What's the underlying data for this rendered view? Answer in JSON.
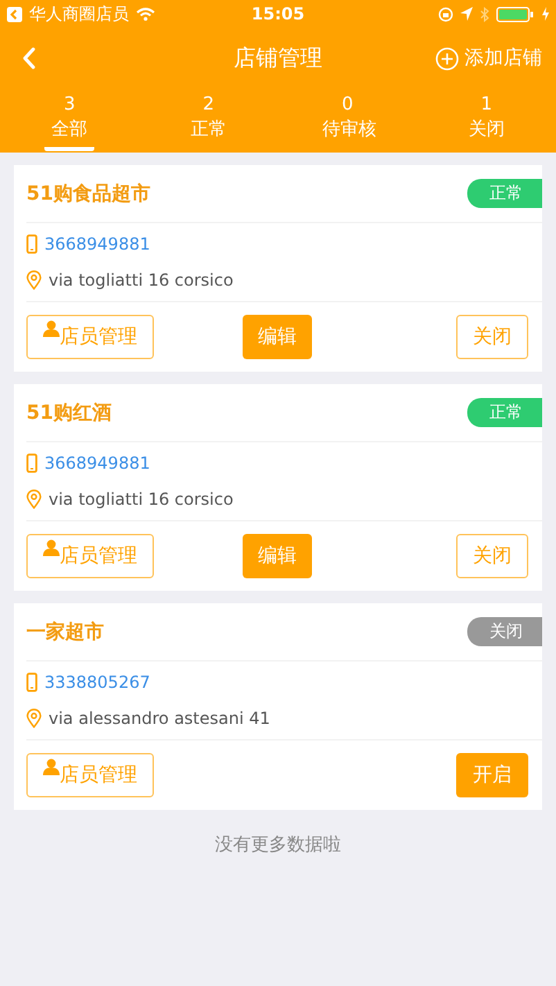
{
  "status_bar": {
    "carrier": "华人商圈店员",
    "time": "15:05"
  },
  "nav": {
    "title": "店铺管理",
    "action": "添加店铺"
  },
  "tabs": [
    {
      "count": "3",
      "label": "全部",
      "selected": true
    },
    {
      "count": "2",
      "label": "正常",
      "selected": false
    },
    {
      "count": "0",
      "label": "待审核",
      "selected": false
    },
    {
      "count": "1",
      "label": "关闭",
      "selected": false
    }
  ],
  "stores": [
    {
      "name": "51购食品超市",
      "status": {
        "label": "正常",
        "color": "#2ecc71"
      },
      "phone": "3668949881",
      "address": "via togliatti 16 corsico",
      "actions": [
        {
          "kind": "staff",
          "label": "店员管理"
        },
        {
          "kind": "edit",
          "label": "编辑"
        },
        {
          "kind": "toggle",
          "label": "关闭",
          "filled": false
        }
      ]
    },
    {
      "name": "51购红酒",
      "status": {
        "label": "正常",
        "color": "#2ecc71"
      },
      "phone": "3668949881",
      "address": "via togliatti 16 corsico",
      "actions": [
        {
          "kind": "staff",
          "label": "店员管理"
        },
        {
          "kind": "edit",
          "label": "编辑"
        },
        {
          "kind": "toggle",
          "label": "关闭",
          "filled": false
        }
      ]
    },
    {
      "name": "一家超市",
      "status": {
        "label": "关闭",
        "color": "#999999"
      },
      "phone": "3338805267",
      "address": "via alessandro astesani 41",
      "actions": [
        {
          "kind": "staff",
          "label": "店员管理"
        },
        {
          "kind": "toggle",
          "label": "开启",
          "filled": true
        }
      ]
    }
  ],
  "footer": "没有更多数据啦"
}
